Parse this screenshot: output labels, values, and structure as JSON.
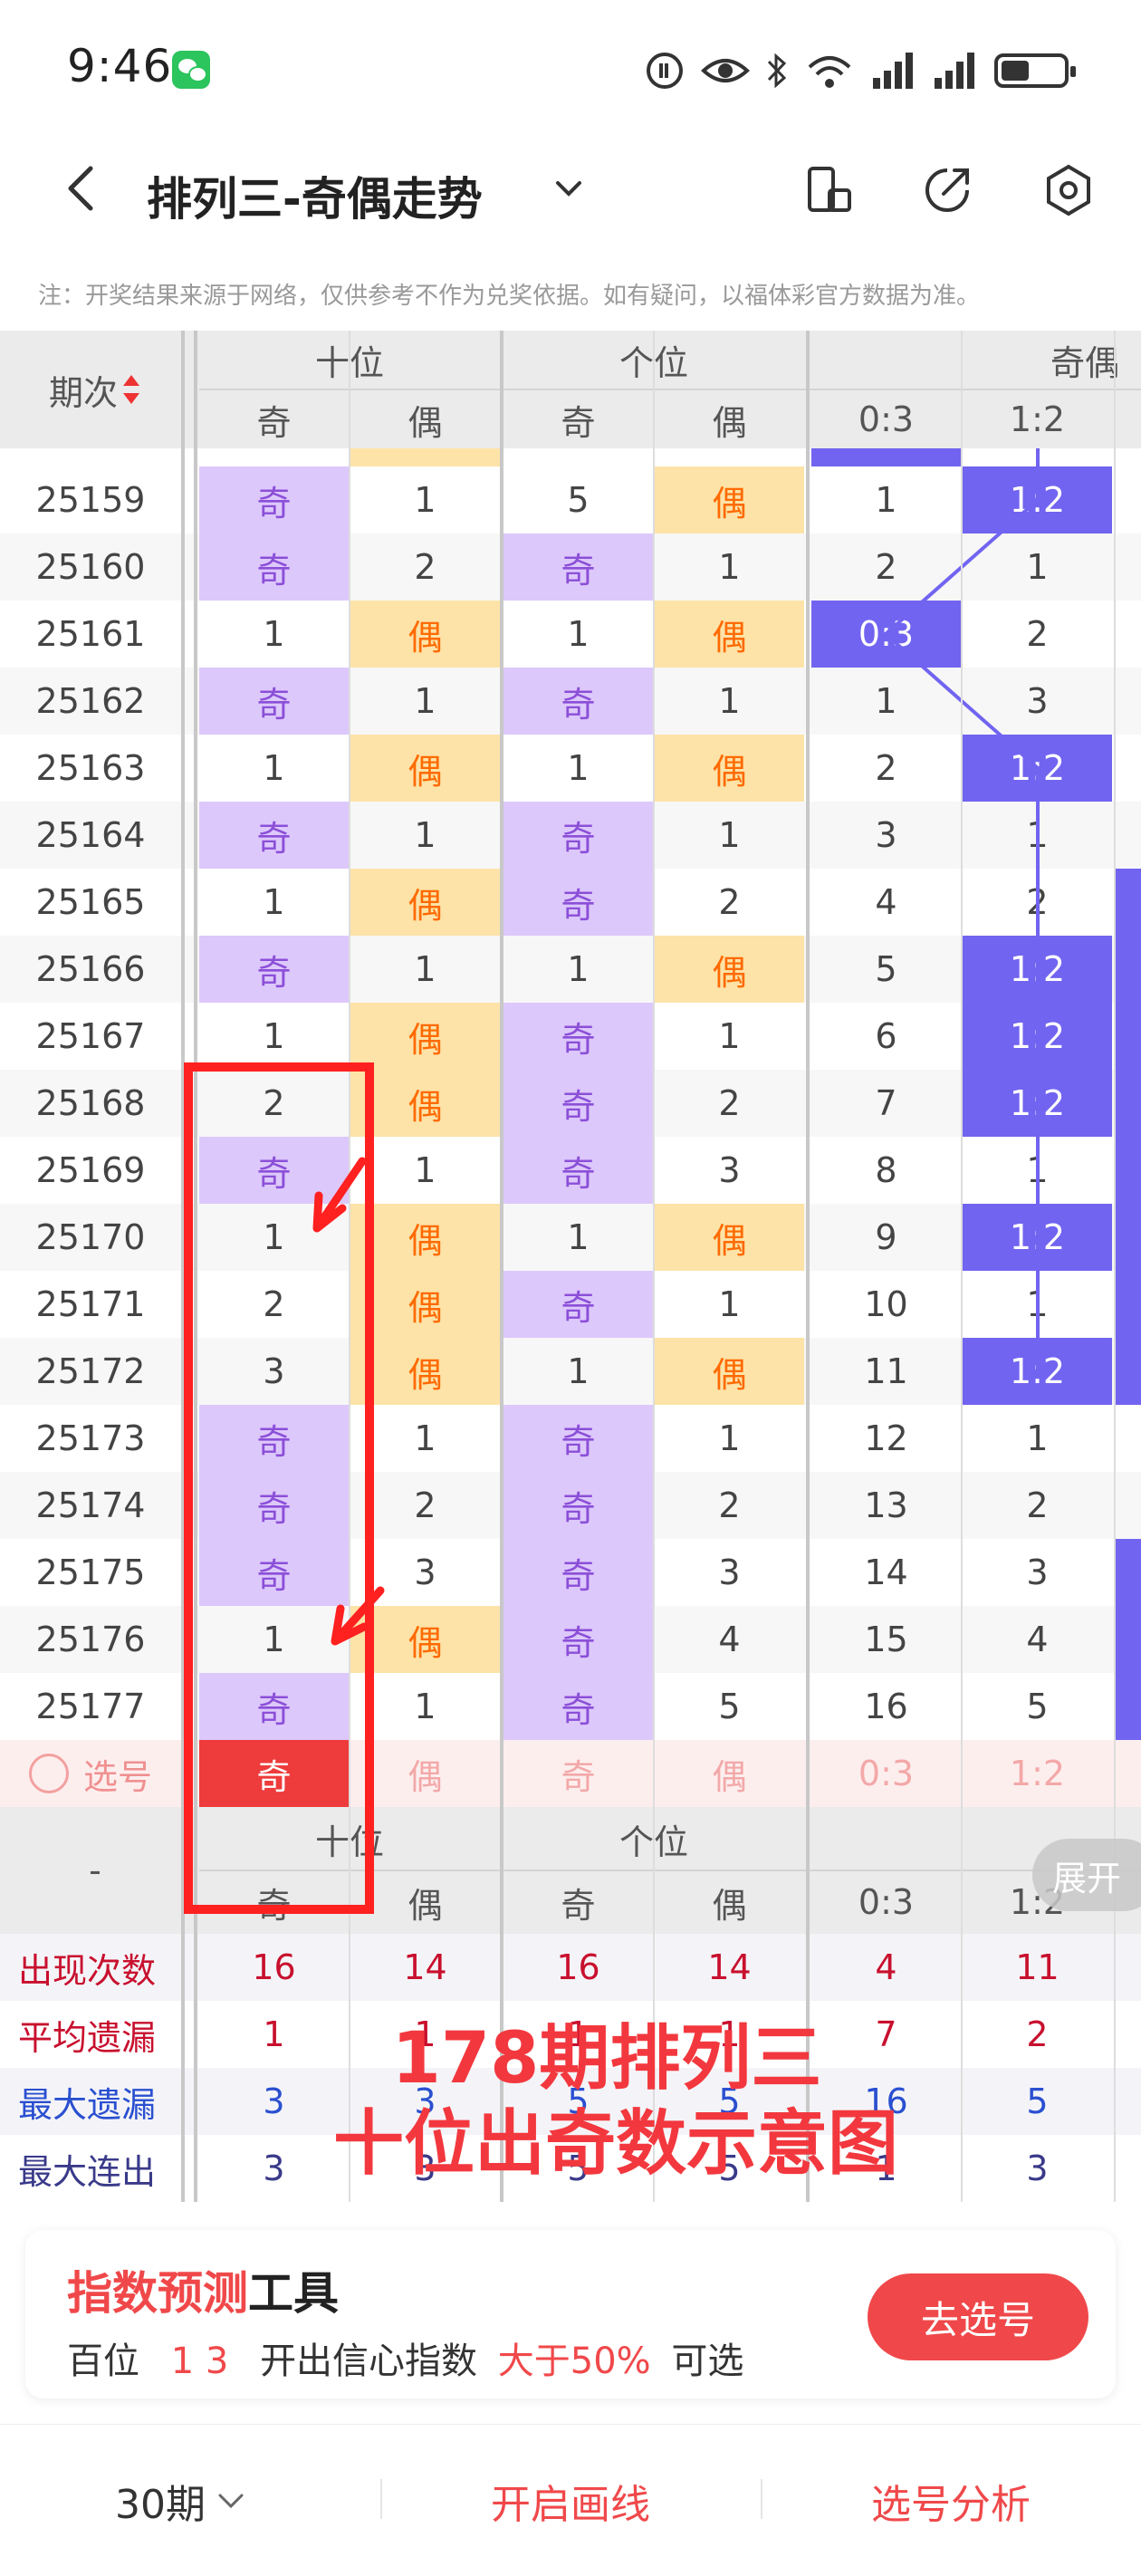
{
  "status": {
    "time": "9:46"
  },
  "header": {
    "title": "排列三-奇偶走势"
  },
  "note": "注：开奖结果来源于网络，仅供参考不作为兑奖依据。如有疑问，以福体彩官方数据为准。",
  "table": {
    "issue_header": "期次",
    "groups": [
      "十位",
      "个位",
      "奇偶"
    ],
    "subheaders": [
      "奇",
      "偶",
      "奇",
      "偶",
      "0:3",
      "1:2"
    ],
    "rows": [
      {
        "issue": "25159",
        "k1": "奇",
        "e1": "1",
        "k2": "5",
        "e2": "偶",
        "r03": "1",
        "r12": "1:2",
        "h": [
          1,
          0,
          0,
          1,
          0,
          1
        ]
      },
      {
        "issue": "25160",
        "k1": "奇",
        "e1": "2",
        "k2": "奇",
        "e2": "1",
        "r03": "2",
        "r12": "1",
        "h": [
          1,
          0,
          1,
          0,
          0,
          0
        ]
      },
      {
        "issue": "25161",
        "k1": "1",
        "e1": "偶",
        "k2": "1",
        "e2": "偶",
        "r03": "0:3",
        "r12": "2",
        "h": [
          0,
          1,
          0,
          1,
          1,
          0
        ]
      },
      {
        "issue": "25162",
        "k1": "奇",
        "e1": "1",
        "k2": "奇",
        "e2": "1",
        "r03": "1",
        "r12": "3",
        "h": [
          1,
          0,
          1,
          0,
          0,
          0
        ]
      },
      {
        "issue": "25163",
        "k1": "1",
        "e1": "偶",
        "k2": "1",
        "e2": "偶",
        "r03": "2",
        "r12": "1:2",
        "h": [
          0,
          1,
          0,
          1,
          0,
          1
        ]
      },
      {
        "issue": "25164",
        "k1": "奇",
        "e1": "1",
        "k2": "奇",
        "e2": "1",
        "r03": "3",
        "r12": "1",
        "h": [
          1,
          0,
          1,
          0,
          0,
          0
        ]
      },
      {
        "issue": "25165",
        "k1": "1",
        "e1": "偶",
        "k2": "奇",
        "e2": "2",
        "r03": "4",
        "r12": "2",
        "h": [
          0,
          1,
          1,
          0,
          0,
          0
        ]
      },
      {
        "issue": "25166",
        "k1": "奇",
        "e1": "1",
        "k2": "1",
        "e2": "偶",
        "r03": "5",
        "r12": "1:2",
        "h": [
          1,
          0,
          0,
          1,
          0,
          1
        ]
      },
      {
        "issue": "25167",
        "k1": "1",
        "e1": "偶",
        "k2": "奇",
        "e2": "1",
        "r03": "6",
        "r12": "1:2",
        "h": [
          0,
          1,
          1,
          0,
          0,
          1
        ]
      },
      {
        "issue": "25168",
        "k1": "2",
        "e1": "偶",
        "k2": "奇",
        "e2": "2",
        "r03": "7",
        "r12": "1:2",
        "h": [
          0,
          1,
          1,
          0,
          0,
          1
        ]
      },
      {
        "issue": "25169",
        "k1": "奇",
        "e1": "1",
        "k2": "奇",
        "e2": "3",
        "r03": "8",
        "r12": "1",
        "h": [
          1,
          0,
          1,
          0,
          0,
          0
        ]
      },
      {
        "issue": "25170",
        "k1": "1",
        "e1": "偶",
        "k2": "1",
        "e2": "偶",
        "r03": "9",
        "r12": "1:2",
        "h": [
          0,
          1,
          0,
          1,
          0,
          1
        ]
      },
      {
        "issue": "25171",
        "k1": "2",
        "e1": "偶",
        "k2": "奇",
        "e2": "1",
        "r03": "10",
        "r12": "1",
        "h": [
          0,
          1,
          1,
          0,
          0,
          0
        ]
      },
      {
        "issue": "25172",
        "k1": "3",
        "e1": "偶",
        "k2": "1",
        "e2": "偶",
        "r03": "11",
        "r12": "1:2",
        "h": [
          0,
          1,
          0,
          1,
          0,
          1
        ]
      },
      {
        "issue": "25173",
        "k1": "奇",
        "e1": "1",
        "k2": "奇",
        "e2": "1",
        "r03": "12",
        "r12": "1",
        "h": [
          1,
          0,
          1,
          0,
          0,
          0
        ]
      },
      {
        "issue": "25174",
        "k1": "奇",
        "e1": "2",
        "k2": "奇",
        "e2": "2",
        "r03": "13",
        "r12": "2",
        "h": [
          1,
          0,
          1,
          0,
          0,
          0
        ]
      },
      {
        "issue": "25175",
        "k1": "奇",
        "e1": "3",
        "k2": "奇",
        "e2": "3",
        "r03": "14",
        "r12": "3",
        "h": [
          1,
          0,
          1,
          0,
          0,
          0
        ]
      },
      {
        "issue": "25176",
        "k1": "1",
        "e1": "偶",
        "k2": "奇",
        "e2": "4",
        "r03": "15",
        "r12": "4",
        "h": [
          0,
          1,
          1,
          0,
          0,
          0
        ]
      },
      {
        "issue": "25177",
        "k1": "奇",
        "e1": "1",
        "k2": "奇",
        "e2": "5",
        "r03": "16",
        "r12": "5",
        "h": [
          1,
          0,
          1,
          0,
          0,
          0
        ]
      }
    ],
    "select_row": {
      "label": "选号",
      "values": [
        "奇",
        "偶",
        "奇",
        "偶",
        "0:3",
        "1:2"
      ]
    },
    "footer_dash": "-",
    "stats": [
      {
        "label": "出现次数",
        "color": "#c8102e",
        "values": [
          "16",
          "14",
          "16",
          "14",
          "4",
          "11"
        ]
      },
      {
        "label": "平均遗漏",
        "color": "#c8102e",
        "values": [
          "1",
          "1",
          "1",
          "1",
          "7",
          "2"
        ]
      },
      {
        "label": "最大遗漏",
        "color": "#2a4fd0",
        "values": [
          "3",
          "3",
          "5",
          "5",
          "16",
          "5"
        ]
      },
      {
        "label": "最大连出",
        "color": "#3a3a8a",
        "values": [
          "3",
          "3",
          "5",
          "5",
          "1",
          "3"
        ]
      }
    ]
  },
  "expand_label": "展开",
  "overlay": {
    "line1": "178期排列三",
    "line2": "十位出奇数示意图"
  },
  "tool": {
    "title_red": "指数预测",
    "title_black": "工具",
    "sub_pos": "百位",
    "sub_nums": "1 3",
    "sub_mid": "开出信心指数",
    "sub_red": "大于50%",
    "sub_end": "可选",
    "button": "去选号"
  },
  "bottom": {
    "period": "30期",
    "draw": "开启画线",
    "analysis": "选号分析"
  },
  "colors": {
    "odd_bg": "#ddc8fb",
    "even_bg": "#fde3a8",
    "ratio_bg": "#7164f0",
    "red": "#f2383e"
  }
}
